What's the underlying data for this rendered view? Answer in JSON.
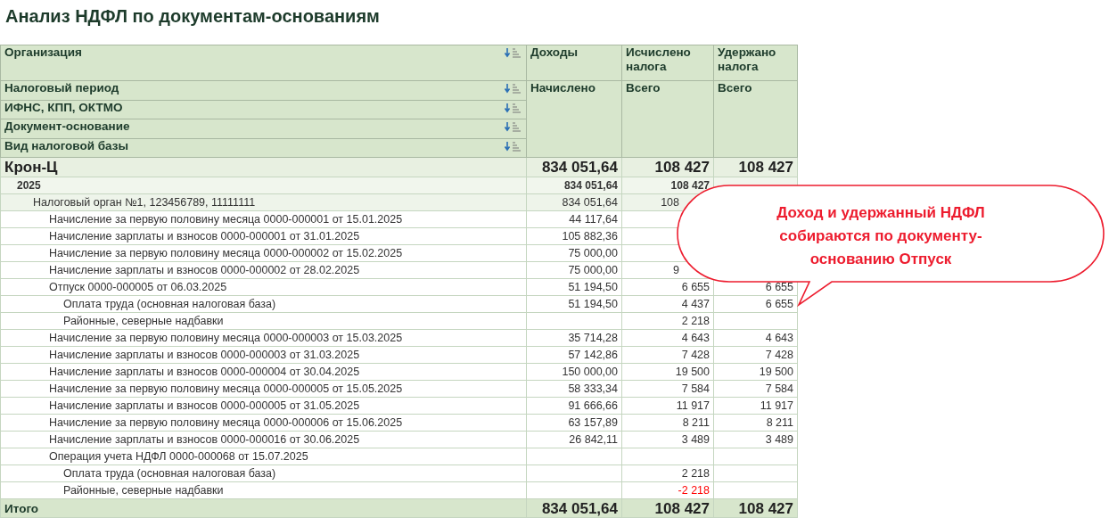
{
  "title": "Анализ НДФЛ по документам-основаниям",
  "grouping": [
    {
      "label": "Организация"
    },
    {
      "label": "Налоговый период"
    },
    {
      "label": "ИФНС, КПП, ОКТМО"
    },
    {
      "label": "Документ-основание"
    },
    {
      "label": "Вид налоговой базы"
    }
  ],
  "columns": [
    {
      "title": "Доходы",
      "subtitle": "Начислено"
    },
    {
      "title": "Исчислено налога",
      "subtitle": "Всего"
    },
    {
      "title": "Удержано налога",
      "subtitle": "Всего"
    }
  ],
  "rows": [
    {
      "label": "Крон-Ц",
      "cells": [
        "834 051,64",
        "108 427",
        "108 427"
      ],
      "children": [
        {
          "label": "2025",
          "cells": [
            "834 051,64",
            "108 427",
            ""
          ],
          "children": [
            {
              "label": "Налоговый орган №1, 123456789, 11111111",
              "cells": [
                "834 051,64",
                "108",
                ""
              ],
              "clipped": [
                false,
                true,
                false
              ],
              "children": [
                {
                  "label": "Начисление за первую половину месяца 0000-000001 от 15.01.2025",
                  "cells": [
                    "44 117,64",
                    "",
                    ""
                  ]
                },
                {
                  "label": "Начисление зарплаты и взносов 0000-000001 от 31.01.2025",
                  "cells": [
                    "105 882,36",
                    "",
                    ""
                  ]
                },
                {
                  "label": "Начисление за первую половину месяца 0000-000002 от 15.02.2025",
                  "cells": [
                    "75 000,00",
                    "",
                    ""
                  ]
                },
                {
                  "label": "Начисление зарплаты и взносов 0000-000002 от 28.02.2025",
                  "cells": [
                    "75 000,00",
                    "9",
                    ""
                  ],
                  "clipped": [
                    false,
                    true,
                    false
                  ]
                },
                {
                  "label": "Отпуск 0000-000005 от 06.03.2025",
                  "cells": [
                    "51 194,50",
                    "6 655",
                    "6 655"
                  ],
                  "children": [
                    {
                      "label": "Оплата труда (основная налоговая база)",
                      "cells": [
                        "51 194,50",
                        "4 437",
                        "6 655"
                      ]
                    },
                    {
                      "label": "Районные, северные надбавки",
                      "cells": [
                        "",
                        "2 218",
                        ""
                      ]
                    }
                  ]
                },
                {
                  "label": "Начисление за первую половину месяца 0000-000003 от 15.03.2025",
                  "cells": [
                    "35 714,28",
                    "4 643",
                    "4 643"
                  ]
                },
                {
                  "label": "Начисление зарплаты и взносов 0000-000003 от 31.03.2025",
                  "cells": [
                    "57 142,86",
                    "7 428",
                    "7 428"
                  ]
                },
                {
                  "label": "Начисление зарплаты и взносов 0000-000004 от 30.04.2025",
                  "cells": [
                    "150 000,00",
                    "19 500",
                    "19 500"
                  ]
                },
                {
                  "label": "Начисление за первую половину месяца 0000-000005 от 15.05.2025",
                  "cells": [
                    "58 333,34",
                    "7 584",
                    "7 584"
                  ]
                },
                {
                  "label": "Начисление зарплаты и взносов 0000-000005 от 31.05.2025",
                  "cells": [
                    "91 666,66",
                    "11 917",
                    "11 917"
                  ]
                },
                {
                  "label": "Начисление за первую половину месяца 0000-000006 от 15.06.2025",
                  "cells": [
                    "63 157,89",
                    "8 211",
                    "8 211"
                  ]
                },
                {
                  "label": "Начисление зарплаты и взносов 0000-000016 от 30.06.2025",
                  "cells": [
                    "26 842,11",
                    "3 489",
                    "3 489"
                  ]
                },
                {
                  "label": "Операция учета НДФЛ 0000-000068 от 15.07.2025",
                  "cells": [
                    "",
                    "",
                    ""
                  ],
                  "children": [
                    {
                      "label": "Оплата труда (основная налоговая база)",
                      "cells": [
                        "",
                        "2 218",
                        ""
                      ]
                    },
                    {
                      "label": "Районные, северные надбавки",
                      "cells": [
                        "",
                        "-2 218",
                        ""
                      ],
                      "negative": true
                    }
                  ]
                }
              ]
            }
          ]
        }
      ]
    }
  ],
  "total": {
    "label": "Итого",
    "cells": [
      "834 051,64",
      "108 427",
      "108 427"
    ]
  },
  "callout": {
    "text": "Доход и удержанный НДФЛ собираются по документу-основанию Отпуск"
  }
}
